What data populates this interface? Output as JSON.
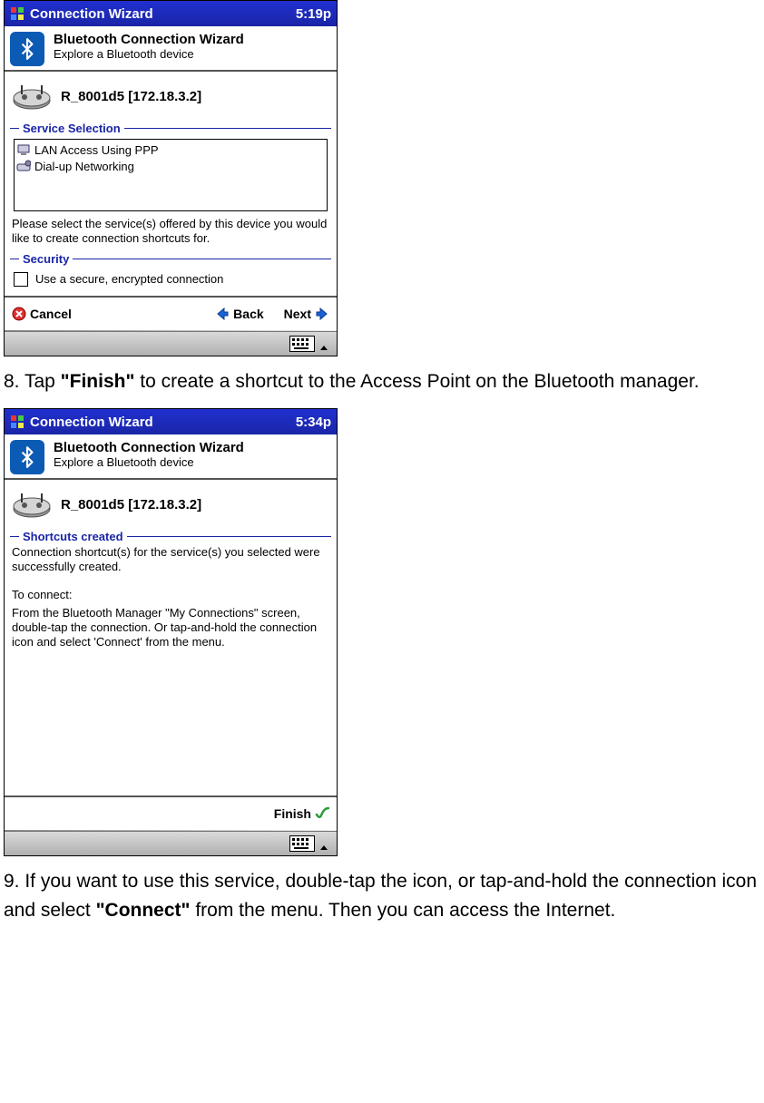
{
  "pda1": {
    "titlebar": {
      "title": "Connection Wizard",
      "time": "5:19p"
    },
    "header": {
      "title": "Bluetooth Connection Wizard",
      "subtitle": "Explore a Bluetooth device"
    },
    "device": {
      "name": "R_8001d5 [172.18.3.2]"
    },
    "section_service": {
      "label": "Service Selection"
    },
    "services": {
      "item0": "LAN Access Using PPP",
      "item1": "Dial-up Networking"
    },
    "service_hint": "Please select the service(s) offered by this device you would like to create connection shortcuts for.",
    "section_security": {
      "label": "Security"
    },
    "security_checkbox_label": "Use a secure, encrypted connection",
    "nav": {
      "cancel": "Cancel",
      "back": "Back",
      "next": "Next"
    }
  },
  "instruction8": {
    "prefix": "8. Tap ",
    "bold": "\"Finish\"",
    "suffix": " to create a shortcut to the Access Point on the Bluetooth manager."
  },
  "pda2": {
    "titlebar": {
      "title": "Connection Wizard",
      "time": "5:34p"
    },
    "header": {
      "title": "Bluetooth Connection Wizard",
      "subtitle": "Explore a Bluetooth device"
    },
    "device": {
      "name": "R_8001d5 [172.18.3.2]"
    },
    "section_shortcuts": {
      "label": "Shortcuts created"
    },
    "msg1": "Connection shortcut(s)  for the service(s) you selected were successfully created.",
    "msg2": "To connect:",
    "msg3": "From the Bluetooth Manager \"My Connections\" screen, double-tap the connection. Or tap-and-hold the connection icon and select 'Connect' from the menu.",
    "nav": {
      "finish": "Finish"
    }
  },
  "instruction9": {
    "prefix": "9. If you want to use this service, double-tap the icon, or tap-and-hold the connection icon and select ",
    "bold": "\"Connect\"",
    "suffix": " from the menu. Then you can access the Internet."
  }
}
